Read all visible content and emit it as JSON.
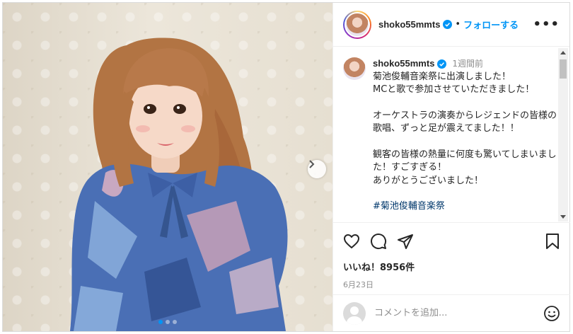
{
  "post": {
    "username": "shoko55mmts",
    "follow_label": "フォローする",
    "separator": "•",
    "more_label": "•••"
  },
  "caption": {
    "username": "shoko55mmts",
    "time": "1週間前",
    "lines": [
      "菊池俊輔音楽祭に出演しました！",
      "MCと歌で参加させていただきました！",
      "オーケストラの演奏からレジェンドの皆様の歌唱、ずっと足が震えてました！！",
      "観客の皆様の熱量に何度も驚いてしまいました！すごすぎる！",
      "ありがとうございました！"
    ],
    "hashtag": "#菊池俊輔音楽祭"
  },
  "stats": {
    "likes": "いいね！8956件",
    "date": "6月23日"
  },
  "comment_box": {
    "placeholder": "コメントを追加..."
  },
  "carousel": {
    "total": 3,
    "active": 1
  },
  "colors": {
    "accent": "#0095f6",
    "hashtag": "#00376b",
    "muted": "#8e8e8e"
  },
  "icons": [
    "heart-icon",
    "comment-icon",
    "share-icon",
    "bookmark-icon",
    "emoji-icon",
    "verified-icon",
    "chevron-right-icon"
  ]
}
